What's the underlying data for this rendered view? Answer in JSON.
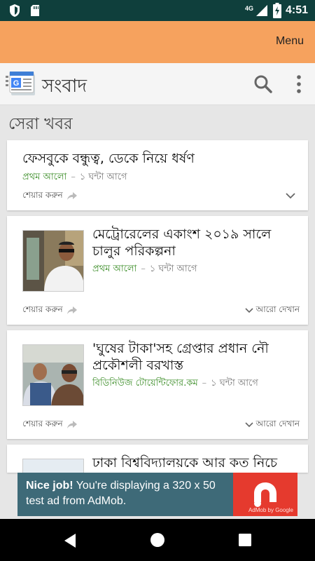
{
  "status_bar": {
    "time": "4:51",
    "network": "4G"
  },
  "app_bar": {
    "menu_label": "Menu"
  },
  "toolbar": {
    "title": "সংবাদ"
  },
  "section": {
    "title": "সেরা খবর"
  },
  "share_label": "শেয়ার করুন",
  "more_label": "আরো দেখান",
  "articles": [
    {
      "headline": "ফেসবুকে বন্ধুত্ব, ডেকে নিয়ে ধর্ষণ",
      "source": "প্রথম আলো",
      "time": "১ ঘন্টা আগে"
    },
    {
      "headline_line1": "মেট্রোরেলের একাংশ ২০১৯ সালে",
      "headline_line2": "চালুর পরিকল্পনা",
      "source": "প্রথম আলো",
      "time": "১ ঘন্টা আগে"
    },
    {
      "headline_line1": "'ঘুষের টাকা'সহ গ্রেপ্তার প্রধান নৌ",
      "headline_line2": "প্রকৌশলী বরখাস্ত",
      "source": "বিডিনিউজ টোয়েন্টিফোর.কম",
      "time": "১ ঘন্টা আগে"
    },
    {
      "headline_line1": "ঢাকা বিশ্ববিদ্যালয়কে আর কত নিচে"
    }
  ],
  "ad": {
    "bold": "Nice job!",
    "text": " You're displaying a 320 x 50 test ad from AdMob.",
    "brand": "AdMob by Google"
  },
  "colors": {
    "accent": "#f6a25e",
    "status_bar": "#0f3f3c",
    "source_green": "#3a8c26",
    "ad_bg": "#3e6a78",
    "ad_red": "#e53a2e"
  }
}
